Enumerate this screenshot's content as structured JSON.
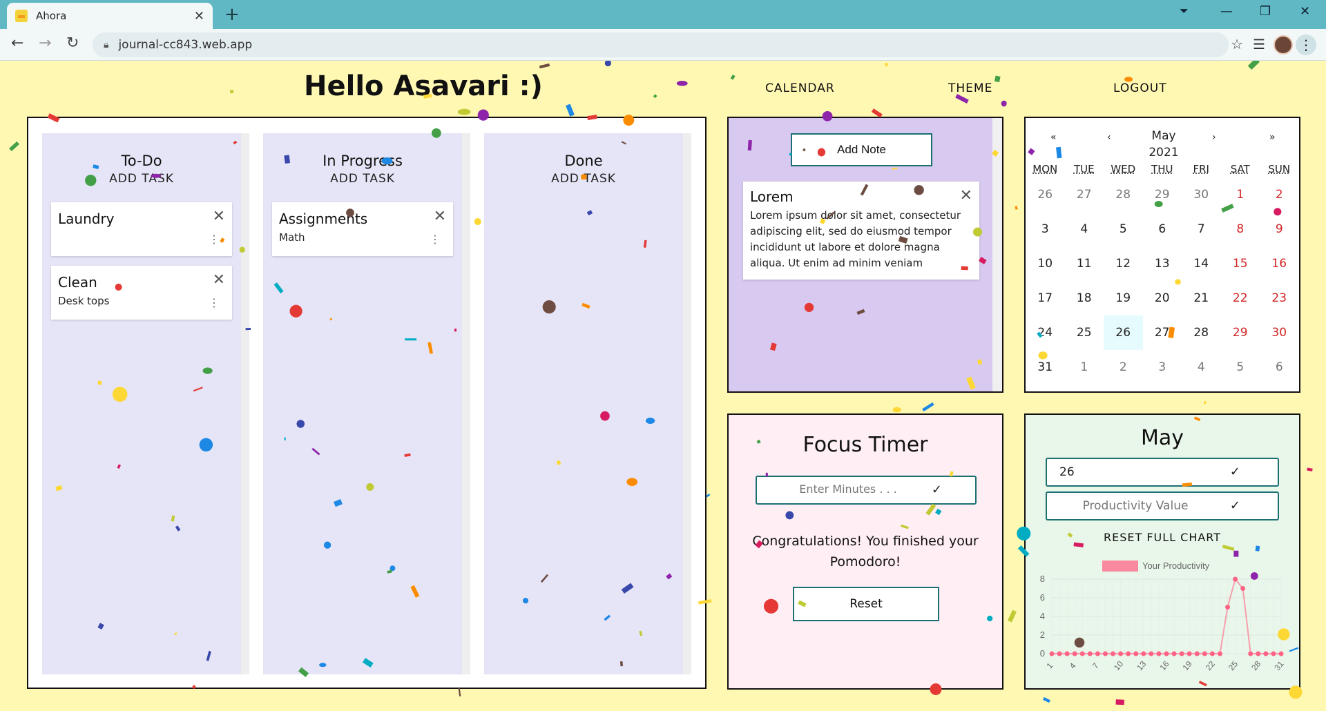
{
  "browser": {
    "tab_title": "Ahora",
    "tab_close": "✕",
    "new_tab": "+",
    "url": "journal-cc843.web.app",
    "minimize": "—",
    "restore": "❐",
    "close": "✕"
  },
  "header": {
    "greeting": "Hello Asavari :)",
    "nav": [
      "CALENDAR",
      "THEME",
      "LOGOUT"
    ]
  },
  "kanban": {
    "columns": [
      {
        "title": "To-Do",
        "add_label": "ADD TASK",
        "cards": [
          {
            "title": "Laundry",
            "subtitle": ""
          },
          {
            "title": "Clean",
            "subtitle": "Desk tops"
          }
        ]
      },
      {
        "title": "In Progress",
        "add_label": "ADD TASK",
        "cards": [
          {
            "title": "Assignments",
            "subtitle": "Math"
          }
        ]
      },
      {
        "title": "Done",
        "add_label": "ADD TASK",
        "cards": []
      }
    ]
  },
  "notes": {
    "add_label": "Add Note",
    "items": [
      {
        "title": "Lorem",
        "body": "Lorem ipsum dolor sit amet, consectetur adipiscing elit, sed do eiusmod tempor incididunt ut labore et dolore magna aliqua. Ut enim ad minim veniam"
      }
    ]
  },
  "calendar": {
    "prev_year": "«",
    "prev_month": "‹",
    "next_month": "›",
    "next_year": "»",
    "month": "May",
    "year": "2021",
    "weekdays": [
      "MON",
      "TUE",
      "WED",
      "THU",
      "FRI",
      "SAT",
      "SUN"
    ],
    "weeks": [
      [
        "26",
        "27",
        "28",
        "29",
        "30",
        "1",
        "2"
      ],
      [
        "3",
        "4",
        "5",
        "6",
        "7",
        "8",
        "9"
      ],
      [
        "10",
        "11",
        "12",
        "13",
        "14",
        "15",
        "16"
      ],
      [
        "17",
        "18",
        "19",
        "20",
        "21",
        "22",
        "23"
      ],
      [
        "24",
        "25",
        "26",
        "27",
        "28",
        "29",
        "30"
      ],
      [
        "31",
        "1",
        "2",
        "3",
        "4",
        "5",
        "6"
      ]
    ],
    "today": "26"
  },
  "timer": {
    "title": "Focus Timer",
    "minutes_placeholder": "Enter Minutes . . .",
    "check": "✓",
    "message": "Congratulations! You finished your Pomodoro!",
    "reset_label": "Reset"
  },
  "productivity": {
    "title": "May",
    "day_value": "26",
    "value_placeholder": "Productivity Value",
    "check": "✓",
    "reset_label": "RESET FULL CHART"
  },
  "chart_data": {
    "type": "line",
    "legend": [
      "Your Productivity"
    ],
    "legend_placement": "top",
    "x": [
      1,
      2,
      3,
      4,
      5,
      6,
      7,
      8,
      9,
      10,
      11,
      12,
      13,
      14,
      15,
      16,
      17,
      18,
      19,
      20,
      21,
      22,
      23,
      24,
      25,
      26,
      27,
      28,
      29,
      30,
      31
    ],
    "x_tick_labels": [
      "1",
      "4",
      "7",
      "10",
      "13",
      "16",
      "19",
      "22",
      "25",
      "28",
      "31"
    ],
    "series": [
      {
        "name": "Your Productivity",
        "values": [
          0,
          0,
          0,
          0,
          0,
          0,
          0,
          0,
          0,
          0,
          0,
          0,
          0,
          0,
          0,
          0,
          0,
          0,
          0,
          0,
          0,
          0,
          0,
          5,
          8,
          7,
          0,
          0,
          0,
          0,
          0
        ]
      }
    ],
    "ylim": [
      0,
      8
    ],
    "y_ticks": [
      0,
      2,
      4,
      6,
      8
    ],
    "grid": true,
    "color": "#ff6384"
  }
}
